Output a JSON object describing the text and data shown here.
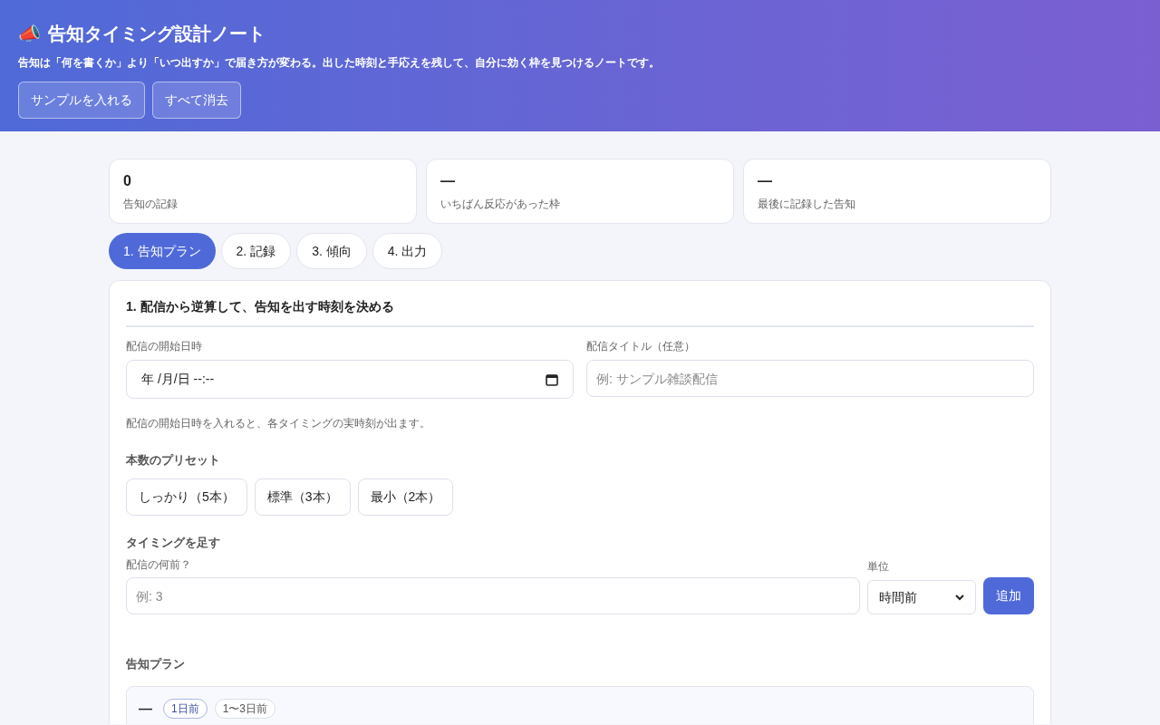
{
  "header": {
    "icon": "📣",
    "title": "告知タイミング設計ノート",
    "subtitle": "告知は「何を書くか」より「いつ出すか」で届き方が変わる。出した時刻と手応えを残して、自分に効く枠を見つけるノートです。",
    "buttons": [
      "サンプルを入れる",
      "すべて消去"
    ]
  },
  "stats": [
    {
      "value": "0",
      "label": "告知の記録"
    },
    {
      "value": "—",
      "label": "いちばん反応があった枠"
    },
    {
      "value": "—",
      "label": "最後に記録した告知"
    }
  ],
  "tabs": [
    {
      "label": "1. 告知プラン",
      "selected": true
    },
    {
      "label": "2. 記録",
      "selected": false
    },
    {
      "label": "3. 傾向",
      "selected": false
    },
    {
      "label": "4. 出力",
      "selected": false
    }
  ],
  "panel": {
    "heading": "1. 配信から逆算して、告知を出す時刻を決める",
    "start_field": {
      "label": "配信の開始日時",
      "value": "年 /月/日 --:--"
    },
    "title_field": {
      "label": "配信タイトル（任意）",
      "placeholder": "例: サンプル雑談配信"
    },
    "hint": "配信の開始日時を入れると、各タイミングの実時刻が出ます。",
    "preset_heading": "本数のプリセット",
    "presets": [
      "しっかり（5本）",
      "標準（3本）",
      "最小（2本）"
    ],
    "add_heading": "タイミングを足す",
    "amount_field": {
      "label": "配信の何前？",
      "placeholder": "例: 3"
    },
    "unit_field": {
      "label": "単位",
      "value": "時間前"
    },
    "add_button": "追加",
    "plan_heading": "告知プラン",
    "plan_items": [
      {
        "time": "—",
        "badges": [
          {
            "text": "1日前",
            "kind": "offset"
          },
          {
            "text": "1〜3日前",
            "kind": "range"
          }
        ]
      }
    ]
  }
}
